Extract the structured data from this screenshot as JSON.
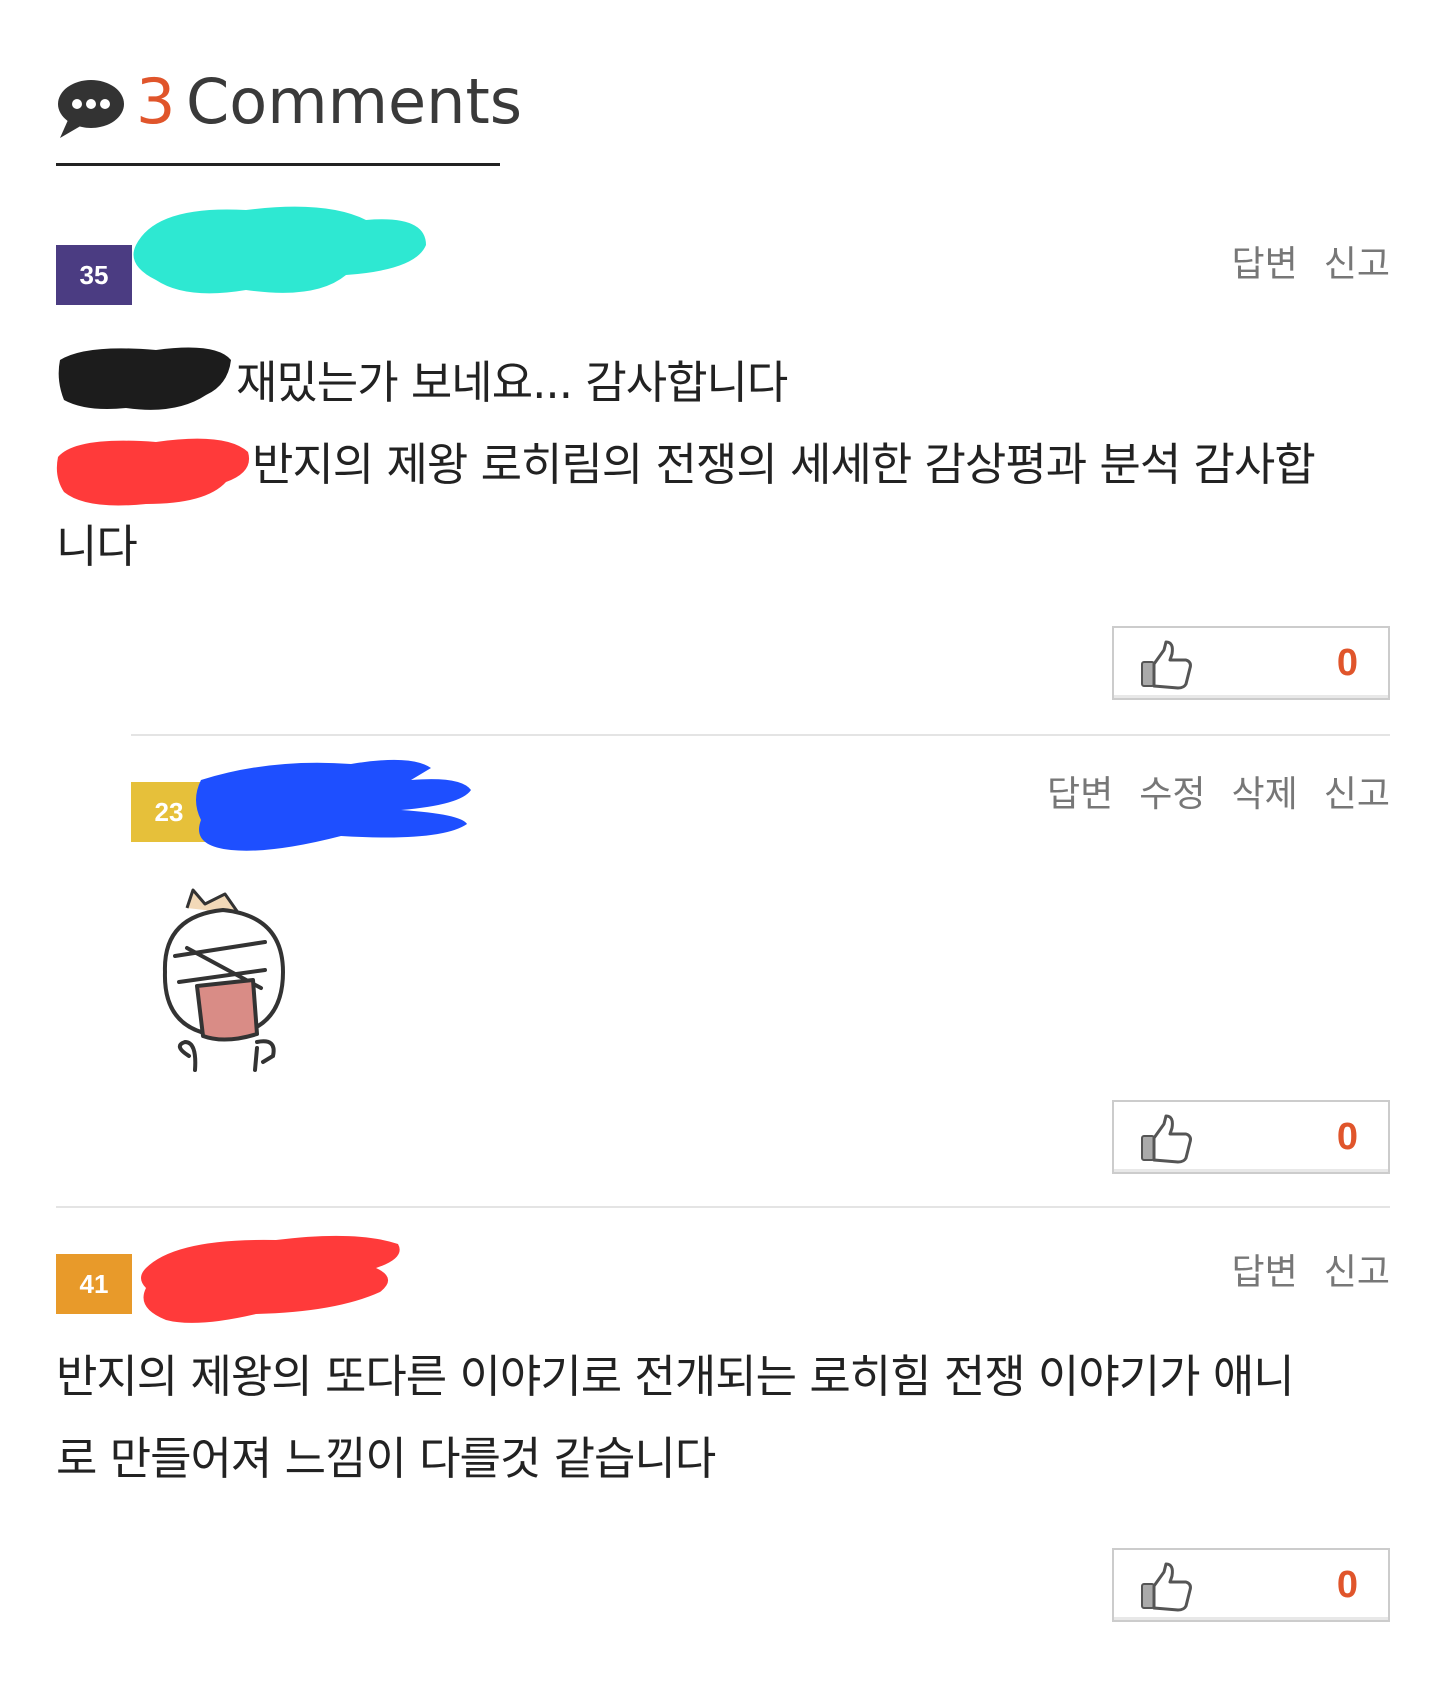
{
  "header": {
    "icon": "speech-bubble-icon",
    "count": "3",
    "label": "Comments"
  },
  "comments": [
    {
      "level": "35",
      "level_color": "#4b3c82",
      "author": "",
      "actions": [
        "답변",
        "신고"
      ],
      "body_line_1": "재밌는가 보네요... 감사합니다",
      "body_line_2": "반지의 제왕 로히림의 전쟁의 세세한 감상평과 분석 감사합",
      "body_line_3": "니다",
      "likes": "0"
    },
    {
      "level": "23",
      "level_color": "#e6c03a",
      "author": "",
      "actions": [
        "답변",
        "수정",
        "삭제",
        "신고"
      ],
      "emoticon": "laughing-face-emoticon",
      "likes": "0"
    },
    {
      "level": "41",
      "level_color": "#e89a2a",
      "author": "",
      "actions": [
        "답변",
        "신고"
      ],
      "body_line_1": "반지의 제왕의 또다른 이야기로 전개되는 로히힘 전쟁 이야기가 애니",
      "body_line_2": "로 만들어져 느낌이 다를것 같습니다",
      "likes": "0"
    }
  ],
  "colors": {
    "accent": "#e0552b",
    "scribble_cyan": "#2ee8d2",
    "scribble_black": "#1c1c1c",
    "scribble_red": "#ff3a3a",
    "scribble_blue": "#1e4fff"
  }
}
